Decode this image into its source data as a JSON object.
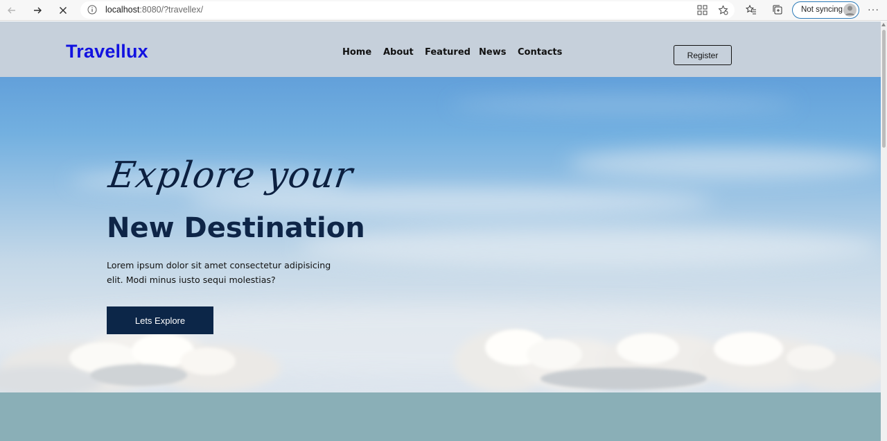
{
  "browser": {
    "url_host": "localhost",
    "url_rest": ":8080/?travellex/",
    "sync_label": "Not syncing",
    "icons": [
      "back-icon",
      "forward-icon",
      "stop-loading-icon",
      "site-info-icon",
      "app-available-icon",
      "add-favorite-icon",
      "favorites-icon",
      "collections-icon",
      "profile-icon",
      "more-icon"
    ]
  },
  "site": {
    "logo": "Travellux",
    "nav": [
      "Home",
      "About",
      "Featured",
      "News",
      "Contacts"
    ],
    "register_label": "Register"
  },
  "hero": {
    "script_title": "Explore your",
    "title": "New Destination",
    "lead": "Lorem ipsum dolor sit amet consectetur adipisicing elit. Modi minus iusto sequi molestias?",
    "cta_label": "Lets Explore"
  },
  "colors": {
    "logo": "#1212e0",
    "header_bg": "#c6d0db",
    "cta_bg": "#0c2648",
    "title": "#0e2547",
    "band_bg": "#8aafb7"
  }
}
